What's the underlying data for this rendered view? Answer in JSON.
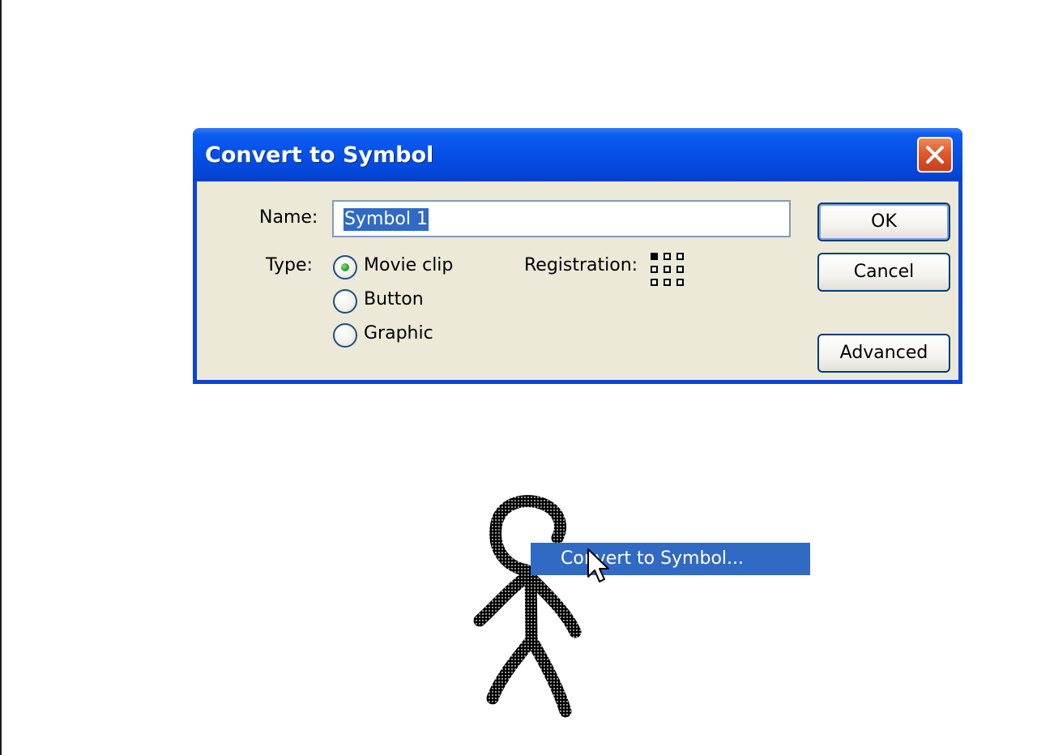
{
  "dialog": {
    "title": "Convert to Symbol",
    "close_icon": "close-icon",
    "name_label": "Name:",
    "name_value": "Symbol 1",
    "type_label": "Type:",
    "type_options": [
      {
        "label": "Movie clip",
        "selected": true
      },
      {
        "label": "Button",
        "selected": false
      },
      {
        "label": "Graphic",
        "selected": false
      }
    ],
    "registration_label": "Registration:",
    "registration_selected": "top-left",
    "buttons": {
      "ok": "OK",
      "cancel": "Cancel",
      "advanced": "Advanced"
    }
  },
  "context_menu": {
    "item_label": "Convert to Symbol..."
  },
  "colors": {
    "title_bar": "#0550e6",
    "dialog_face": "#ece9d8",
    "close_button": "#e0582a",
    "selection": "#316ac5",
    "radio_selected": "#2ea62e"
  },
  "icons": {
    "cursor": "arrow-cursor-icon",
    "registration": "registration-grid-icon"
  }
}
